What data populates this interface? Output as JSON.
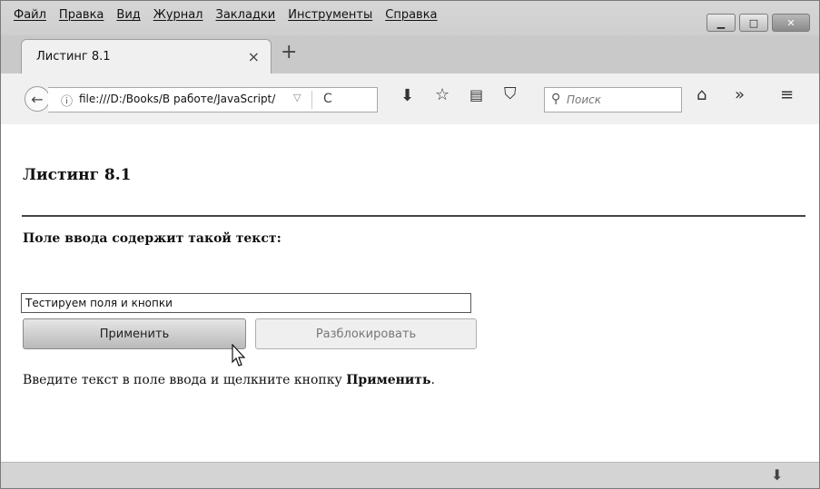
{
  "menubar": {
    "items": [
      "Файл",
      "Правка",
      "Вид",
      "Журнал",
      "Закладки",
      "Инструменты",
      "Справка"
    ]
  },
  "tab": {
    "title": "Листинг 8.1",
    "close": "×"
  },
  "newtab": {
    "label": "+"
  },
  "navbar": {
    "url": "file:///D:/Books/В работе/JavaScript/",
    "search_placeholder": "Поиск"
  },
  "page": {
    "heading": "Листинг 8.1",
    "field_label": "Поле ввода содержит такой текст:",
    "input_value": "Тестируем поля и кнопки",
    "apply_button": "Применить",
    "unlock_button": "Разблокировать",
    "hint_prefix": "Введите текст в поле ввода и щелкните кнопку ",
    "hint_bold": "Применить",
    "hint_suffix": "."
  },
  "icons": [
    "back-arrow-icon",
    "info-icon",
    "dropdown-icon",
    "reload-icon",
    "download-icon",
    "star-icon",
    "reading-list-icon",
    "pocket-icon",
    "search-icon",
    "home-icon",
    "overflow-icon",
    "menu-icon"
  ]
}
